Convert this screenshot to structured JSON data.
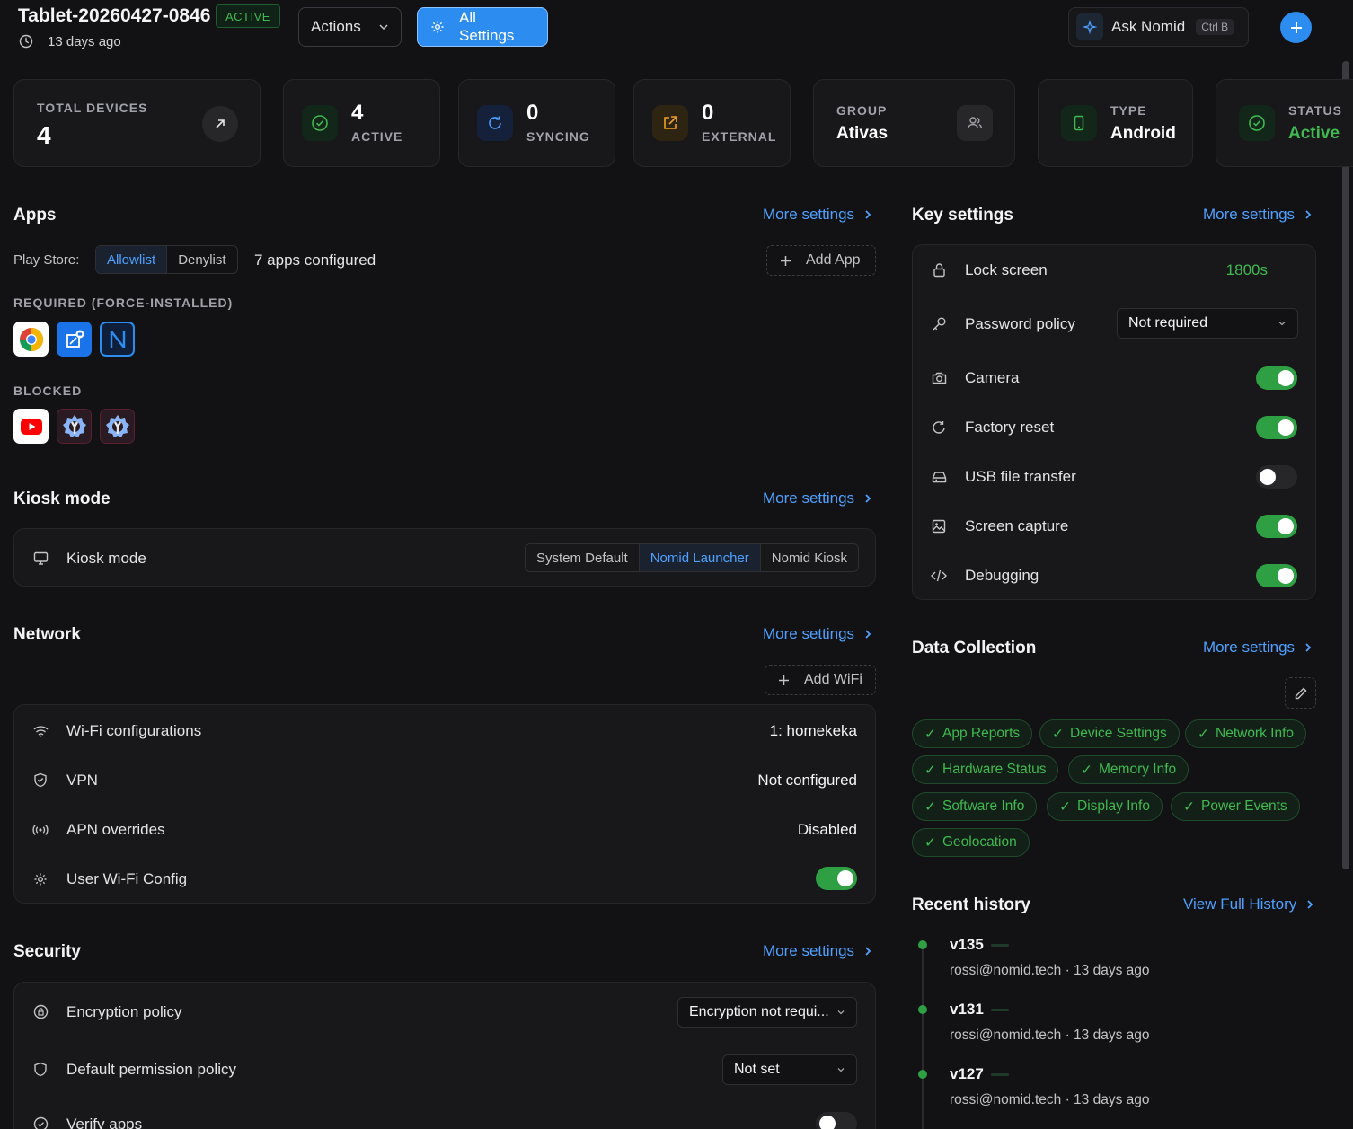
{
  "header": {
    "device_name": "Tablet-20260427-0846",
    "status_badge": "ACTIVE",
    "last_seen": "13 days ago",
    "actions_label": "Actions",
    "all_settings_label": "All Settings",
    "ask_label": "Ask Nomid",
    "ask_shortcut": "Ctrl B"
  },
  "stats": {
    "total_devices": {
      "label": "TOTAL DEVICES",
      "value": "4"
    },
    "active": {
      "label": "ACTIVE",
      "value": "4"
    },
    "syncing": {
      "label": "SYNCING",
      "value": "0"
    },
    "external": {
      "label": "EXTERNAL",
      "value": "0"
    },
    "group": {
      "label": "GROUP",
      "value": "Ativas"
    },
    "type": {
      "label": "TYPE",
      "value": "Android"
    },
    "status": {
      "label": "STATUS",
      "value": "Active"
    }
  },
  "apps": {
    "title": "Apps",
    "more": "More settings",
    "play_store_label": "Play Store:",
    "allowlist": "Allowlist",
    "denylist": "Denylist",
    "configured": "7 apps configured",
    "add_app": "Add App",
    "required_label": "REQUIRED (FORCE-INSTALLED)",
    "blocked_label": "BLOCKED"
  },
  "kiosk": {
    "title": "Kiosk mode",
    "more": "More settings",
    "row_label": "Kiosk mode",
    "options": [
      "System Default",
      "Nomid Launcher",
      "Nomid Kiosk"
    ]
  },
  "network": {
    "title": "Network",
    "more": "More settings",
    "add_wifi": "Add WiFi",
    "wifi_label": "Wi-Fi configurations",
    "wifi_value": "1: homekeka",
    "vpn_label": "VPN",
    "vpn_value": "Not configured",
    "apn_label": "APN overrides",
    "apn_value": "Disabled",
    "user_wifi_label": "User Wi-Fi Config"
  },
  "security": {
    "title": "Security",
    "more": "More settings",
    "encryption_label": "Encryption policy",
    "encryption_value": "Encryption not requi...",
    "permission_label": "Default permission policy",
    "permission_value": "Not set",
    "verify_label": "Verify apps"
  },
  "key_settings": {
    "title": "Key settings",
    "more": "More settings",
    "lock_label": "Lock screen",
    "lock_value": "1800s",
    "password_label": "Password policy",
    "password_value": "Not required",
    "camera_label": "Camera",
    "factory_label": "Factory reset",
    "usb_label": "USB file transfer",
    "capture_label": "Screen capture",
    "debug_label": "Debugging"
  },
  "data_collection": {
    "title": "Data Collection",
    "more": "More settings",
    "chips": [
      "App Reports",
      "Device Settings",
      "Network Info",
      "Hardware Status",
      "Memory Info",
      "Software Info",
      "Display Info",
      "Power Events",
      "Geolocation"
    ]
  },
  "history": {
    "title": "Recent history",
    "link": "View Full History",
    "items": [
      {
        "version": "v135",
        "meta": "rossi@nomid.tech · 13 days ago"
      },
      {
        "version": "v131",
        "meta": "rossi@nomid.tech · 13 days ago"
      },
      {
        "version": "v127",
        "meta": "rossi@nomid.tech · 13 days ago"
      }
    ]
  },
  "colors": {
    "accent_blue": "#4ea1ff",
    "active_green": "#3fb950",
    "toggle_green": "#2ea043",
    "background": "#121214"
  }
}
